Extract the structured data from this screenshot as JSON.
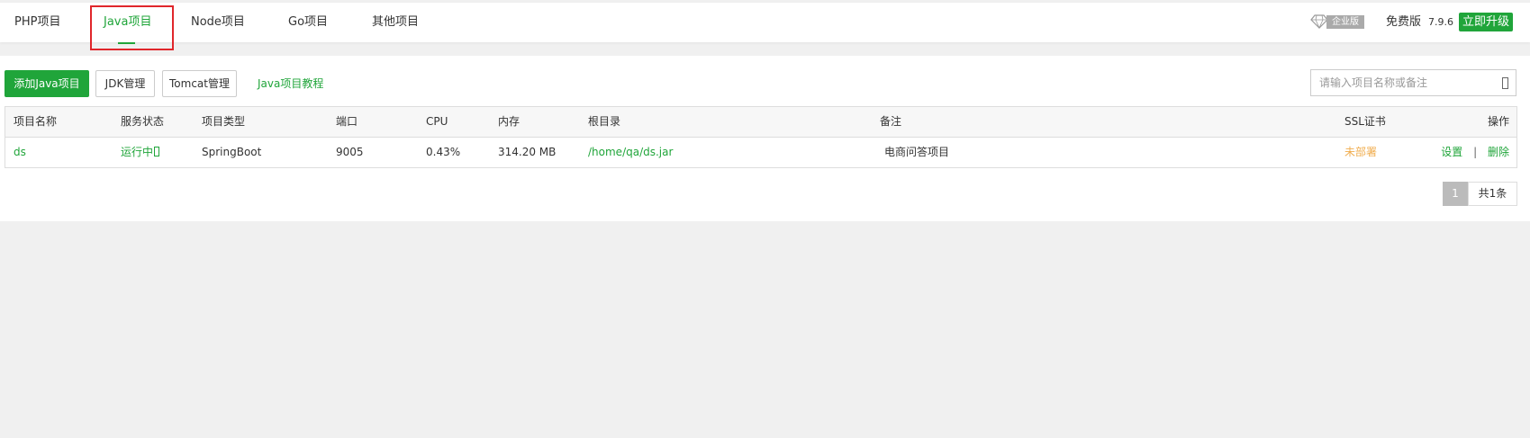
{
  "tabs": [
    {
      "label": "PHP项目",
      "active": false
    },
    {
      "label": "Java项目",
      "active": true
    },
    {
      "label": "Node项目",
      "active": false
    },
    {
      "label": "Go项目",
      "active": false
    },
    {
      "label": "其他项目",
      "active": false
    }
  ],
  "header": {
    "enterprise_icon": "diamond-icon",
    "enterprise_label": "企业版",
    "edition": "免费版",
    "version": "7.9.6",
    "upgrade_label": "立即升级"
  },
  "toolbar": {
    "add_label": "添加Java项目",
    "jdk_label": "JDK管理",
    "tomcat_label": "Tomcat管理",
    "tutorial_label": "Java项目教程",
    "search_placeholder": "请输入项目名称或备注",
    "search_value": ""
  },
  "table": {
    "columns": [
      "项目名称",
      "服务状态",
      "项目类型",
      "端口",
      "CPU",
      "内存",
      "根目录",
      "备注",
      "SSL证书",
      "操作"
    ],
    "rows": [
      {
        "name": "ds",
        "status": "运行中",
        "type": "SpringBoot",
        "port": "9005",
        "cpu": "0.43%",
        "memory": "314.20 MB",
        "path": "/home/qa/ds.jar",
        "note": "电商问答项目",
        "ssl": "未部署",
        "action_settings": "设置",
        "action_sep": "|",
        "action_delete": "删除"
      }
    ]
  },
  "pagination": {
    "current_page": "1",
    "total_label": "共1条"
  },
  "colors": {
    "accent": "#20a53a",
    "warning": "#f0ad4e",
    "highlight_border": "#e0262b"
  }
}
